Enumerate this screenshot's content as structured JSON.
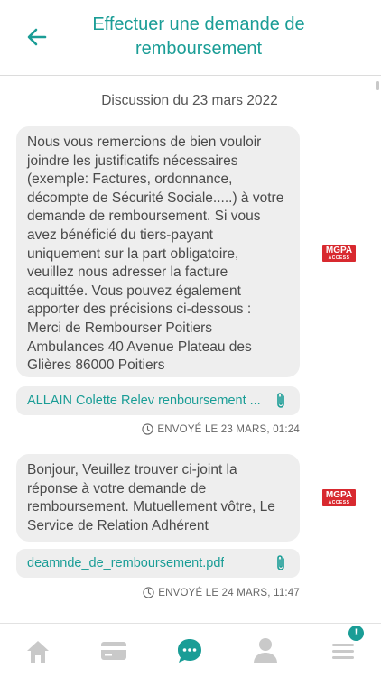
{
  "header": {
    "title": "Effectuer une demande de remboursement"
  },
  "discussion": {
    "date_label": "Discussion du 23 mars 2022"
  },
  "messages": [
    {
      "text": "Nous vous remercions de bien vouloir joindre les justificatifs nécessaires (exemple: Factures, ordonnance, décompte de Sécurité Sociale.....) à votre demande de remboursement. Si vous avez bénéficié du tiers-payant uniquement sur la part obligatoire, veuillez nous adresser la facture acquittée. Vous pouvez également apporter des précisions ci-dessous : Merci de Rembourser Poitiers Ambulances 40 Avenue Plateau des Glières 86000 Poitiers",
      "attachment": "ALLAIN Colette Relev renboursement ...",
      "status": "ENVOYÉ LE 23 MARS, 01:24",
      "logo": {
        "name": "MGPA",
        "sub": "ACCESS"
      }
    },
    {
      "text": "Bonjour, Veuillez trouver ci-joint la réponse à votre demande de remboursement. Mutuellement vôtre, Le Service de Relation Adhérent",
      "attachment": "deamnde_de_remboursement.pdf",
      "status": "ENVOYÉ LE 24 MARS, 11:47",
      "logo": {
        "name": "MGPA",
        "sub": "ACCESS"
      }
    }
  ],
  "tabbar": {
    "items": [
      "home-icon",
      "card-icon",
      "chat-icon",
      "user-icon",
      "menu-icon"
    ],
    "active": "chat-icon",
    "menu_badge": "!"
  },
  "colors": {
    "accent": "#1a9d96",
    "bubble": "#eeeeee",
    "brand_logo": "#d8292f",
    "inactive_icon": "#c9c9c9"
  }
}
